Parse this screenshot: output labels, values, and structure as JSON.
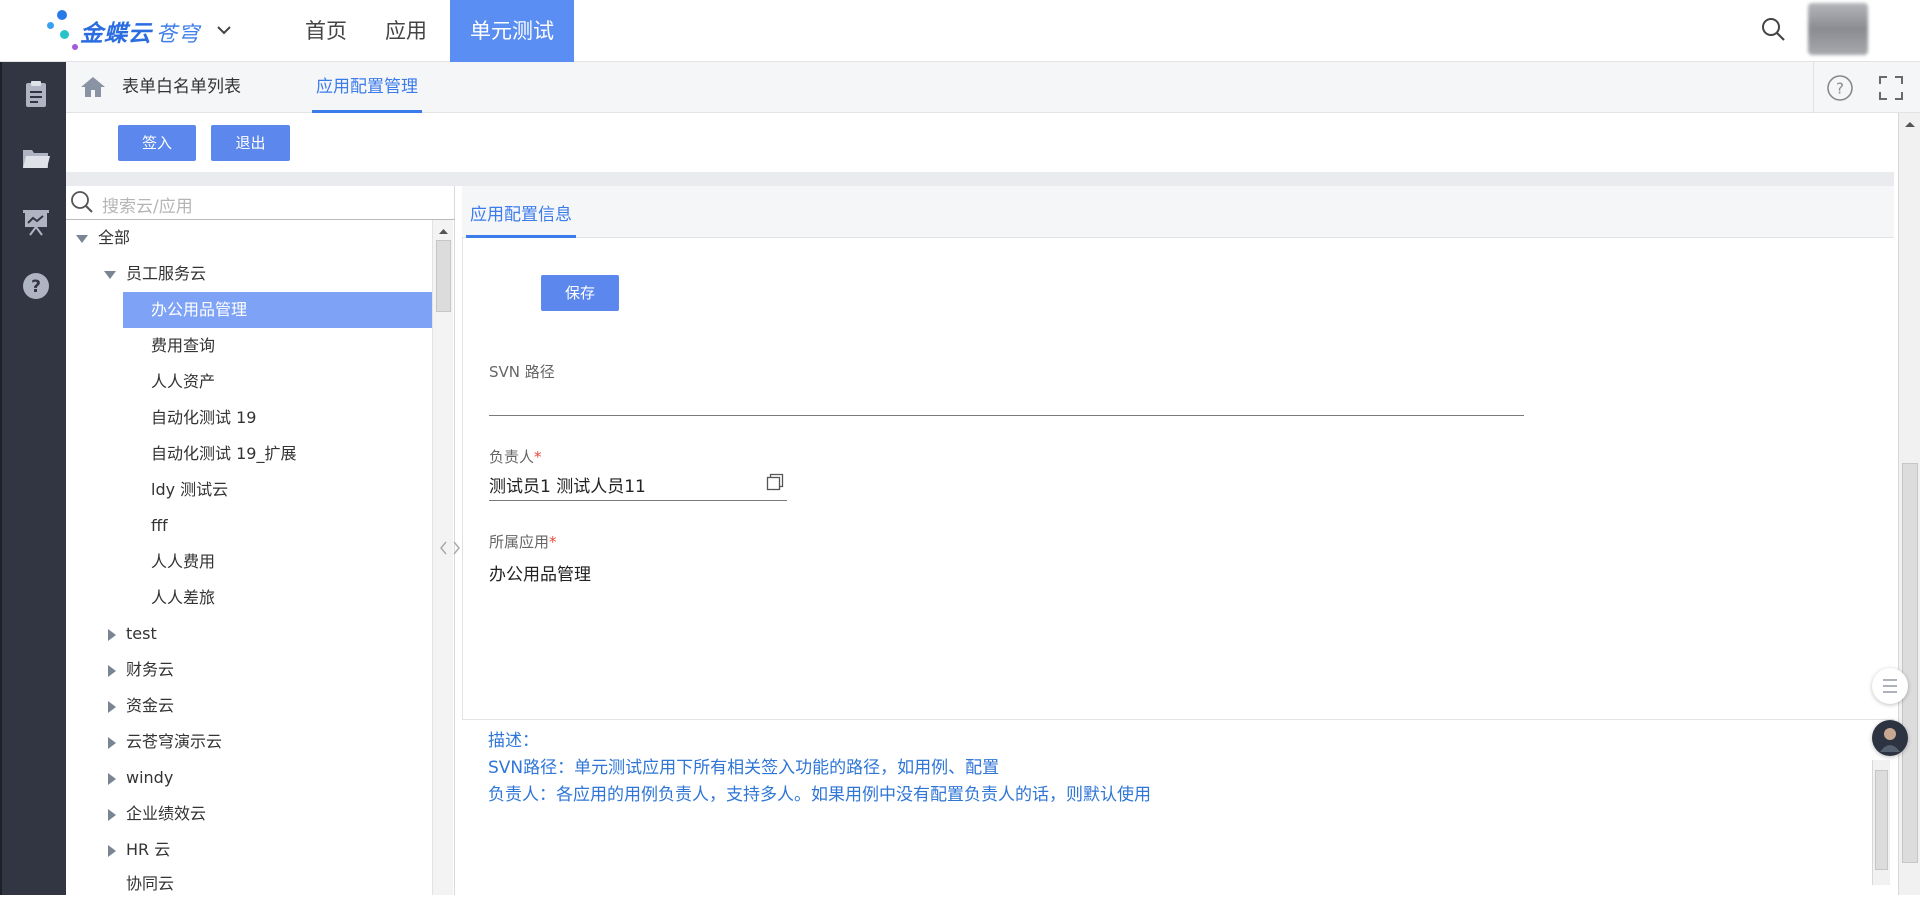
{
  "header": {
    "logo_text": "金蝶云",
    "logo_sub": "苍穹",
    "nav": [
      "首页",
      "应用",
      "单元测试"
    ],
    "active_nav_index": 2
  },
  "tabs": {
    "items": [
      "表单白名单列表",
      "应用配置管理"
    ],
    "active_index": 1
  },
  "toolbar": {
    "checkin_label": "签入",
    "exit_label": "退出"
  },
  "tree": {
    "search_placeholder": "搜索云/应用",
    "root": "全部",
    "expanded_group": "员工服务云",
    "apps": [
      "办公用品管理",
      "费用查询",
      "人人资产",
      "自动化测试 19",
      "自动化测试 19_扩展",
      "ldy 测试云",
      "fff",
      "人人费用",
      "人人差旅"
    ],
    "selected_app": "办公用品管理",
    "collapsed_groups": [
      "test",
      "财务云",
      "资金云",
      "云苍穹演示云",
      "windy",
      "企业绩效云",
      "HR 云",
      "协同云"
    ]
  },
  "detail": {
    "tab_label": "应用配置信息",
    "save_label": "保存",
    "svn_label": "SVN 路径",
    "svn_value": "",
    "owner_label": "负责人",
    "owner_value": "测试员1 测试人员11",
    "app_label": "所属应用",
    "app_value": "办公用品管理",
    "required_mark": "*"
  },
  "description": {
    "title": "描述：",
    "line1": "SVN路径：单元测试应用下所有相关签入功能的路径，如用例、配置",
    "line2": "负责人：各应用的用例负责人，支持多人。如果用例中没有配置负责人的话，则默认使用"
  },
  "colors": {
    "accent": "#3c7bea",
    "active_nav_bg": "#5b8ef3",
    "selected_row_bg": "#7ea2f5",
    "rail_bg": "#323643",
    "description_text": "#2f76d6",
    "required": "#e8463c"
  },
  "icons": [
    "chevron-down-icon",
    "search-icon",
    "clipboard-icon",
    "folder-icon",
    "presentation-icon",
    "help-icon",
    "home-icon",
    "fullscreen-icon",
    "lookup-icon",
    "list-icon"
  ]
}
